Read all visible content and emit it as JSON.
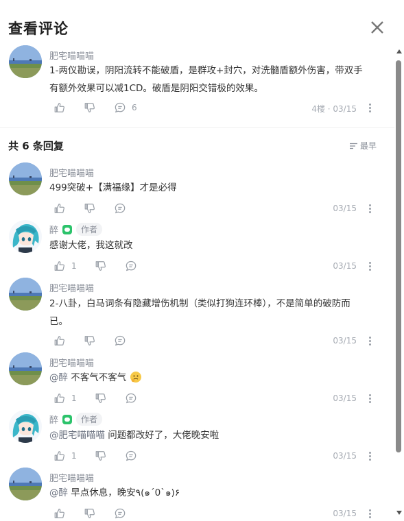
{
  "dialog": {
    "title": "查看评论"
  },
  "main_comment": {
    "author": "肥宅喵喵喵",
    "text_line1": "1-两仪勘误，阴阳流转不能破盾，是群攻+封穴，对洗髓盾额外伤害，带双手",
    "text_line2": "有额外效果可以减1CD。破盾是阴阳交错极的效果。",
    "reply_count": "6",
    "floor_time": "4楼 · 03/15"
  },
  "replies_header": {
    "prefix": "共",
    "count": "6",
    "suffix": "条回复",
    "sort_label": "最早"
  },
  "replies": [
    {
      "author": "肥宅喵喵喵",
      "text": "499突破+【满福缘】才是必得",
      "likes": "",
      "time": "03/15"
    },
    {
      "author": "醉",
      "tag": "作者",
      "text": "感谢大佬，我这就改",
      "likes": "1",
      "time": "03/15"
    },
    {
      "author": "肥宅喵喵喵",
      "text_line1": "2-八卦，白马词条有隐藏增伤机制（类似打狗连环棒），不是简单的破防而",
      "text_line2": "已。",
      "likes": "",
      "time": "03/15"
    },
    {
      "author": "肥宅喵喵喵",
      "mention": "@醉",
      "text": "不客气不客气",
      "likes": "1",
      "time": "03/15"
    },
    {
      "author": "醉",
      "tag": "作者",
      "mention": "@肥宅喵喵喵",
      "text": "问题都改好了，大佬晚安啦",
      "likes": "1",
      "time": "03/15"
    },
    {
      "author": "肥宅喵喵喵",
      "mention": "@醉",
      "text": "早点休息，晚安٩(๑´0`๑)۶",
      "likes": "",
      "time": "03/15"
    }
  ]
}
